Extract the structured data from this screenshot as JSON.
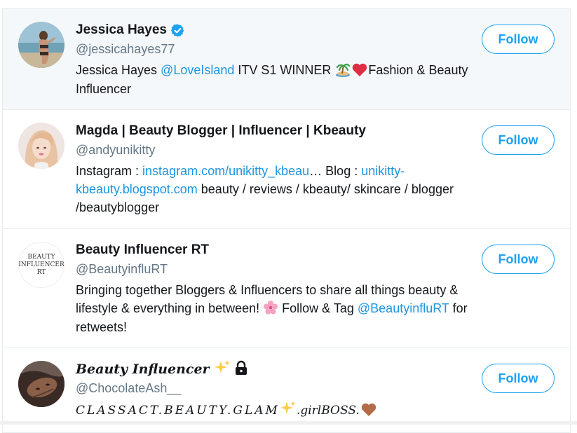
{
  "users": [
    {
      "name": "Jessica Hayes",
      "handle": "@jessicahayes77",
      "verified": true,
      "follow_label": "Follow",
      "bio": [
        {
          "t": "Jessica Hayes ",
          "link": false
        },
        {
          "t": "@LoveIsland",
          "link": true
        },
        {
          "t": " ITV S1 WINNER ",
          "link": false
        },
        {
          "emoji": "island-icon"
        },
        {
          "emoji": "heart-icon"
        },
        {
          "t": "Fashion & Beauty Influencer",
          "link": false
        }
      ]
    },
    {
      "name": "Magda | Beauty Blogger | Influencer | Kbeauty",
      "handle": "@andyunikitty",
      "verified": false,
      "follow_label": "Follow",
      "bio": [
        {
          "t": "Instagram : ",
          "link": false
        },
        {
          "t": "instagram.com/unikitty_kbeau",
          "link": true
        },
        {
          "t": "… Blog : ",
          "link": false
        },
        {
          "t": "unikitty-kbeauty.blogspot.com",
          "link": true
        },
        {
          "t": " beauty / reviews / kbeauty/ skincare / blogger /beautyblogger",
          "link": false
        }
      ]
    },
    {
      "name": "Beauty Influencer RT",
      "handle": "@BeautyinfluRT",
      "verified": false,
      "follow_label": "Follow",
      "avatar_text": [
        "BEAUTY",
        "INFLUENCER",
        "RT"
      ],
      "bio": [
        {
          "t": "Bringing together Bloggers & Influencers to share all things beauty & lifestyle & everything in between! ",
          "link": false
        },
        {
          "emoji": "blossom-icon"
        },
        {
          "t": " Follow & Tag ",
          "link": false
        },
        {
          "t": "@BeautyinfluRT",
          "link": true
        },
        {
          "t": " for retweets!",
          "link": false
        }
      ]
    },
    {
      "name": "Beauty Influencer",
      "handle": "@ChocolateAsh__",
      "verified": false,
      "follow_label": "Follow",
      "bio": [
        {
          "t": "CLASSACT.BEAUTY.GLAM",
          "link": false
        },
        {
          "emoji": "sparkles-icon"
        },
        {
          "t": ".girlBOSS.",
          "link": false
        },
        {
          "emoji": "brown-heart-icon"
        }
      ]
    }
  ],
  "colors": {
    "accent": "#1da1f2",
    "link": "#1b95e0",
    "hover_bg": "#f5f8fa",
    "border": "#e6ecf0",
    "muted": "#657786"
  }
}
